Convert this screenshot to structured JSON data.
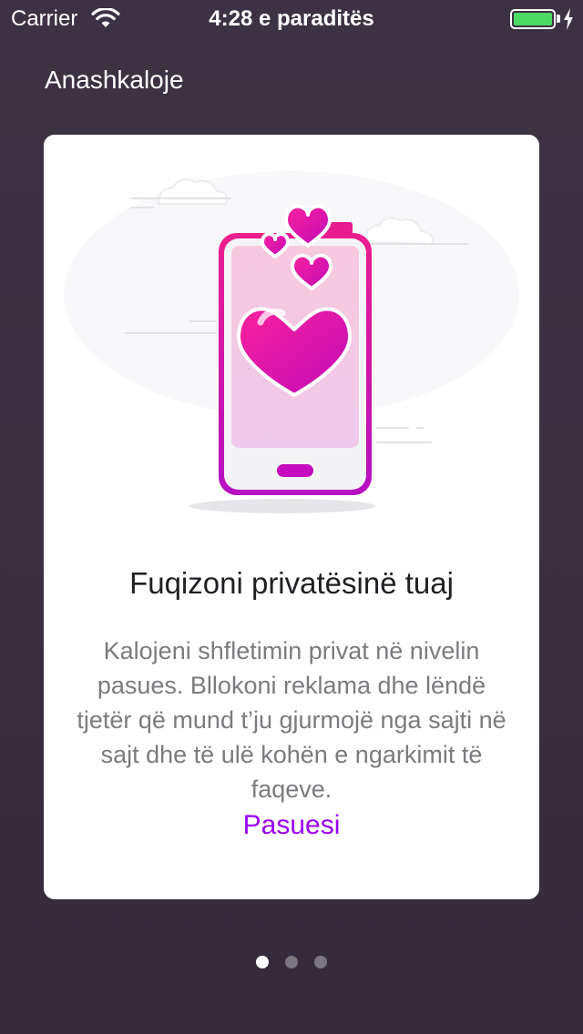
{
  "status_bar": {
    "carrier": "Carrier",
    "time": "4:28 e paraditës",
    "battery_color": "#4cd964"
  },
  "header": {
    "skip_label": "Anashkaloje"
  },
  "card": {
    "title": "Fuqizoni privatësinë tuaj",
    "body": "Kalojeni shfletimin privat në nivelin pasues. Bllokoni reklama dhe lëndë tjetër që mund t’ju gjurmojë nga sajti në sajt dhe të ulë kohën e ngarkimit të faqeve.",
    "link_label": "Pasuesi",
    "accent_color": "#9900ee",
    "illustration": "phone-with-hearts-illustration"
  },
  "pager": {
    "count": 3,
    "active_index": 0
  }
}
